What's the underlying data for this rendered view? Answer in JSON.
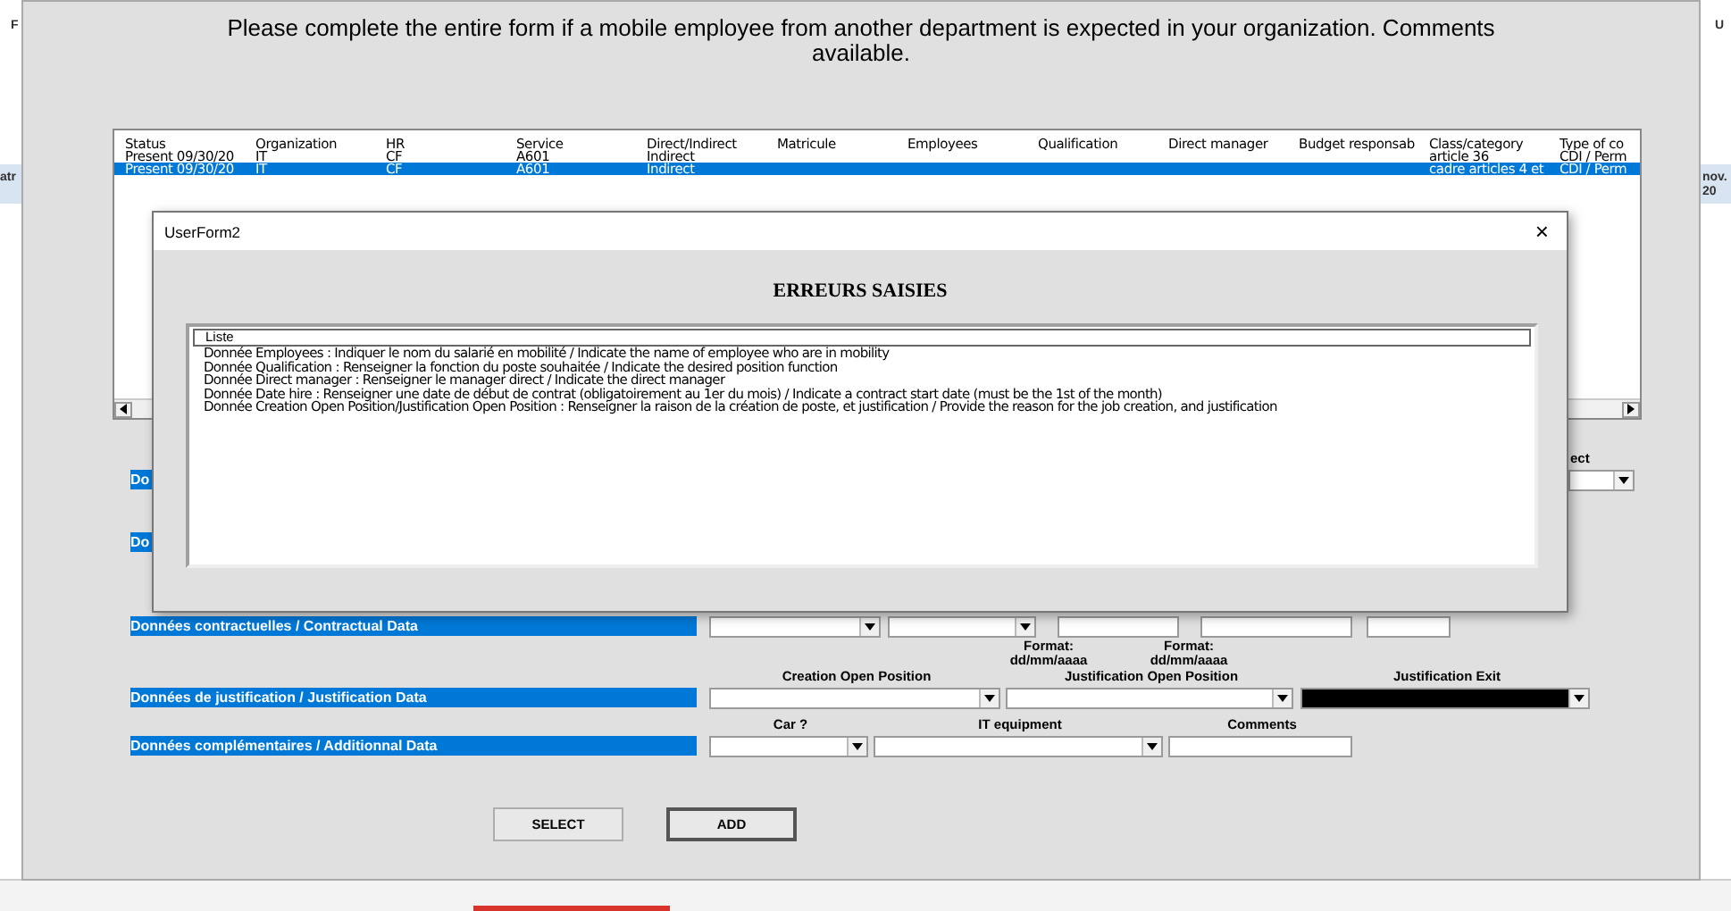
{
  "sheet": {
    "left_fragments": [
      "F",
      "atr"
    ],
    "right_fragments": [
      "U",
      "nov.",
      "20"
    ]
  },
  "form": {
    "instruction": "Please complete the entire form if a mobile employee from another department is expected in your organization. Comments available.",
    "listbox": {
      "columns": [
        "Status",
        "Organization",
        "HR",
        "Service",
        "Direct/Indirect",
        "Matricule",
        "Employees",
        "Qualification",
        "Direct manager",
        "Budget responsab",
        "Class/category",
        "Type of co"
      ],
      "rows": [
        {
          "selected": false,
          "cells": [
            "Present 09/30/20",
            "IT",
            "CF",
            "A601",
            "Indirect",
            "",
            "",
            "",
            "",
            "",
            "article 36",
            "CDI / Perm"
          ]
        },
        {
          "selected": true,
          "cells": [
            "Present 09/30/20",
            "IT",
            "CF",
            "A601",
            "Indirect",
            "",
            "",
            "",
            "",
            "",
            "cadre articles 4 et",
            "CDI / Perm"
          ]
        }
      ]
    },
    "sections": [
      {
        "label": "Do",
        "fields": [
          {
            "kind": "dropdown",
            "heading": "ect",
            "disabled": false
          }
        ]
      },
      {
        "label": "Do"
      },
      {
        "label": "Données contractuelles / Contractual Data",
        "fields": [
          {
            "kind": "dropdown"
          },
          {
            "kind": "dropdown"
          },
          {
            "kind": "text",
            "note": "Format: dd/mm/aaaa"
          },
          {
            "kind": "text",
            "note": "Format: dd/mm/aaaa"
          },
          {
            "kind": "text"
          }
        ]
      },
      {
        "label": "Données de justification / Justification Data",
        "fields": [
          {
            "kind": "dropdown",
            "heading": "Creation Open Position",
            "disabled": false
          },
          {
            "kind": "dropdown",
            "heading": "Justification Open Position",
            "disabled": false
          },
          {
            "kind": "dropdown",
            "heading": "Justification Exit",
            "disabled": true
          }
        ]
      },
      {
        "label": "Données complémentaires / Additionnal Data",
        "fields": [
          {
            "kind": "dropdown",
            "heading": "Car ?",
            "disabled": false
          },
          {
            "kind": "dropdown",
            "heading": "IT equipment",
            "disabled": false
          },
          {
            "kind": "text",
            "heading": "Comments",
            "disabled": false
          }
        ]
      }
    ],
    "buttons": [
      {
        "label": "SELECT",
        "default": false
      },
      {
        "label": "ADD",
        "default": true
      }
    ]
  },
  "dialog": {
    "title": "UserForm2",
    "close": "×",
    "heading": "ERREURS SAISIES",
    "list_header": "Liste",
    "errors": [
      "Donnée Employees : Indiquer le nom du salarié en mobilité / Indicate the name of employee who are in mobility",
      "Donnée Qualification : Renseigner la fonction du poste souhaitée / Indicate the desired position function",
      "Donnée Direct manager : Renseigner le manager direct / Indicate the direct manager",
      "Donnée Date hire : Renseigner une date de début de contrat (obligatoirement au 1er du mois) / Indicate a contract start date (must be the 1st of the month)",
      "Donnée Creation Open Position/Justification Open Position : Renseigner la raison de la création de poste, et justification / Provide the reason for the job creation, and justification"
    ]
  }
}
